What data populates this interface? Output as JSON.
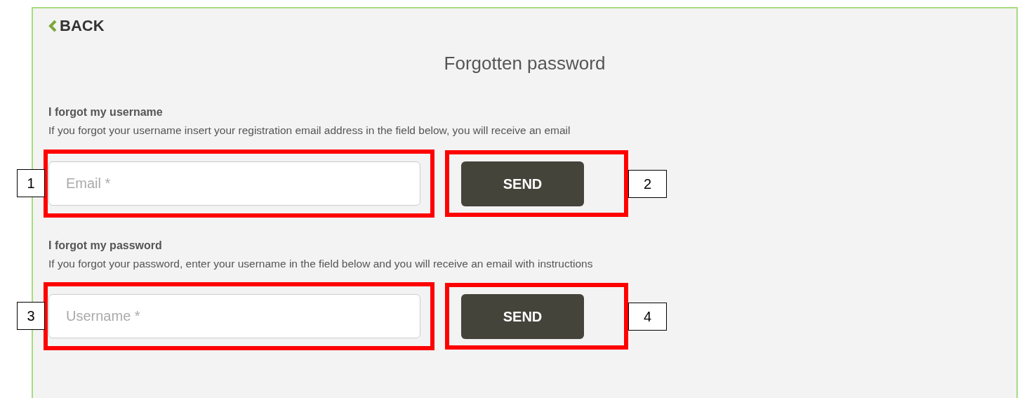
{
  "back": {
    "label": "BACK"
  },
  "title": "Forgotten password",
  "sections": [
    {
      "heading": "I forgot my username",
      "description": "If you forgot your username insert your registration email address in the field below, you will receive an email",
      "field": {
        "placeholder": "Email *"
      },
      "button": "SEND",
      "annotations": [
        "1",
        "2"
      ]
    },
    {
      "heading": "I forgot my password",
      "description": "If you forgot your password, enter your username in the field below and you will receive an email with instructions",
      "field": {
        "placeholder": "Username *"
      },
      "button": "SEND",
      "annotations": [
        "3",
        "4"
      ]
    }
  ]
}
